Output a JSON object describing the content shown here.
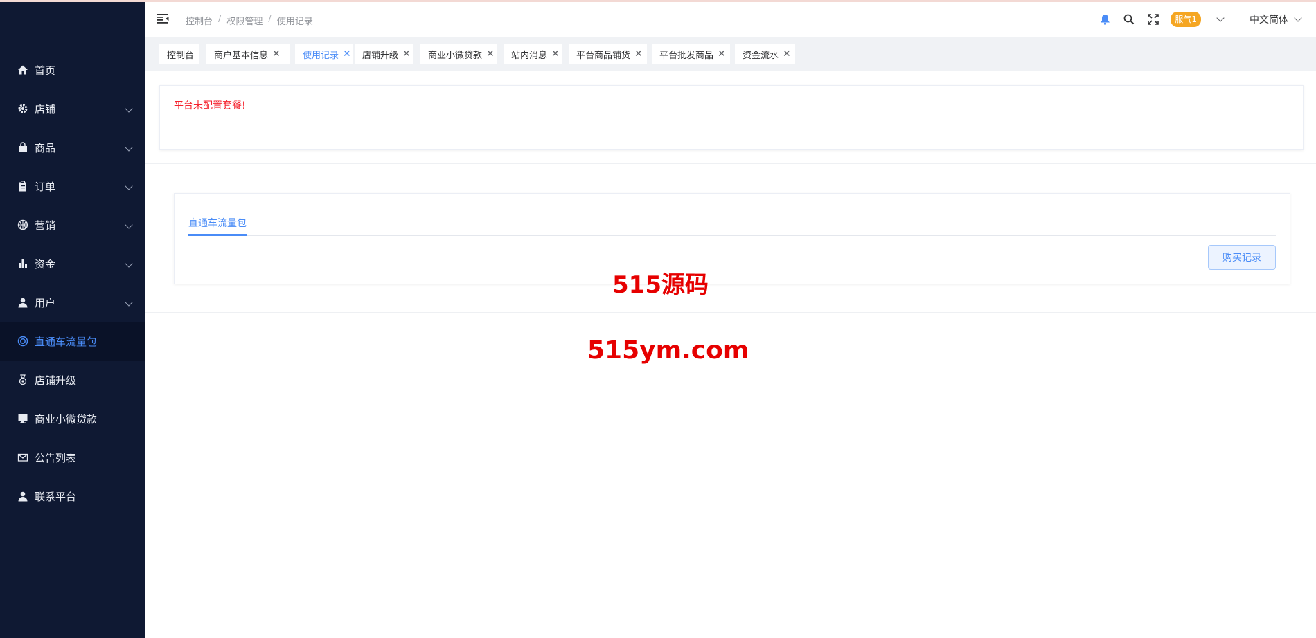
{
  "sidebar": {
    "items": [
      {
        "label": "首页",
        "icon": "home-icon",
        "has_children": false,
        "active": false
      },
      {
        "label": "店铺",
        "icon": "gear-icon",
        "has_children": true,
        "active": false
      },
      {
        "label": "商品",
        "icon": "shopping-bag-icon",
        "has_children": true,
        "active": false
      },
      {
        "label": "订单",
        "icon": "clipboard-icon",
        "has_children": true,
        "active": false
      },
      {
        "label": "营销",
        "icon": "basketball-icon",
        "has_children": true,
        "active": false
      },
      {
        "label": "资金",
        "icon": "bar-chart-icon",
        "has_children": true,
        "active": false
      },
      {
        "label": "用户",
        "icon": "user-icon",
        "has_children": true,
        "active": false
      },
      {
        "label": "直通车流量包",
        "icon": "lifebuoy-icon",
        "has_children": false,
        "active": true
      },
      {
        "label": "店铺升级",
        "icon": "medal-icon",
        "has_children": false,
        "active": false
      },
      {
        "label": "商业小微贷款",
        "icon": "monitor-icon",
        "has_children": false,
        "active": false
      },
      {
        "label": "公告列表",
        "icon": "mail-icon",
        "has_children": false,
        "active": false
      },
      {
        "label": "联系平台",
        "icon": "user-icon",
        "has_children": false,
        "active": false
      }
    ]
  },
  "header": {
    "breadcrumb": [
      "控制台",
      "权限管理",
      "使用记录"
    ],
    "breadcrumb_sep": "/",
    "badge": "服气1",
    "language": "中文简体"
  },
  "tags": [
    {
      "label": "控制台",
      "closable": false,
      "active": false
    },
    {
      "label": "商户基本信息",
      "closable": true,
      "active": false
    },
    {
      "label": "使用记录",
      "closable": true,
      "active": true
    },
    {
      "label": "店铺升级",
      "closable": true,
      "active": false
    },
    {
      "label": "商业小微贷款",
      "closable": true,
      "active": false
    },
    {
      "label": "站内消息",
      "closable": true,
      "active": false
    },
    {
      "label": "平台商品铺货",
      "closable": true,
      "active": false
    },
    {
      "label": "平台批发商品",
      "closable": true,
      "active": false
    },
    {
      "label": "资金流水",
      "closable": true,
      "active": false
    }
  ],
  "notice": {
    "warning": "平台未配置套餐!"
  },
  "panel": {
    "tab_label": "直通车流量包",
    "buy_records_button": "购买记录"
  },
  "watermark": {
    "line1": "515源码",
    "line2": "515ym.com"
  },
  "colors": {
    "sidebar_bg": "#0f1933",
    "accent": "#4a8cf7",
    "warning": "#f5222d",
    "badge": "#f5a623",
    "watermark": "#e60000"
  }
}
